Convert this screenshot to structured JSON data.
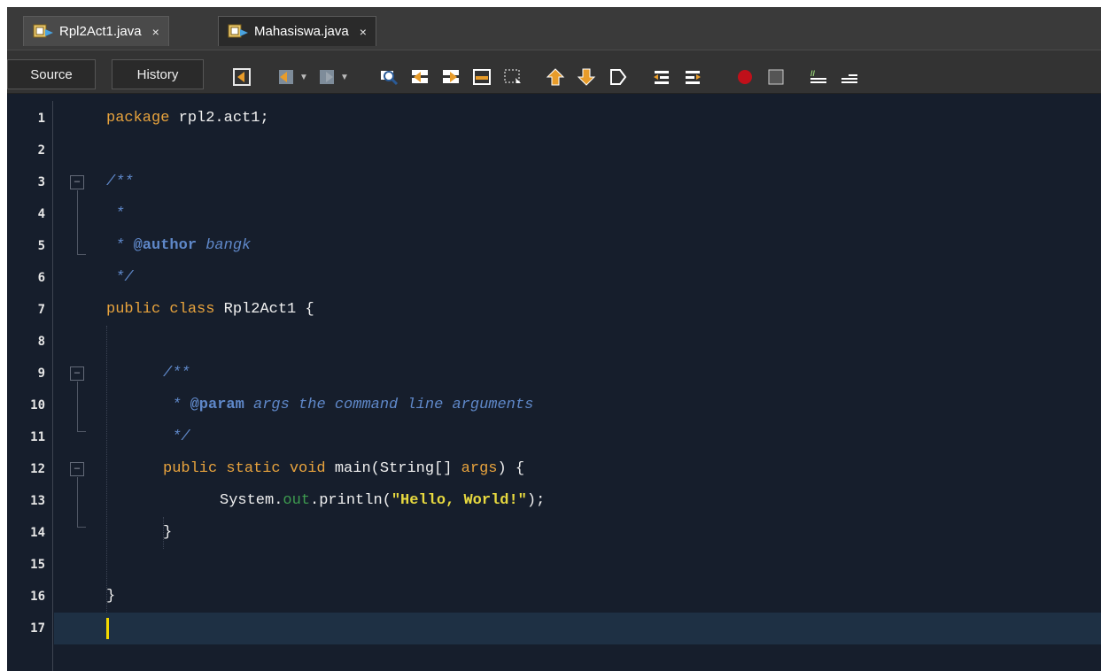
{
  "tabs": [
    {
      "label": "Rpl2Act1.java",
      "close": "×",
      "active": true
    },
    {
      "label": "Mahasiswa.java",
      "close": "×",
      "active": false
    }
  ],
  "toolbar": {
    "source_label": "Source",
    "history_label": "History",
    "icons": [
      "last-edit-icon",
      "back-icon",
      "forward-icon",
      "find-icon",
      "find-previous-icon",
      "find-next-icon",
      "toggle-highlight-icon",
      "toggle-rect-selection-icon",
      "previous-bookmark-icon",
      "next-bookmark-icon",
      "toggle-bookmark-icon",
      "shift-left-icon",
      "shift-right-icon",
      "record-macro-icon",
      "stop-macro-icon",
      "comment-icon",
      "uncomment-icon"
    ]
  },
  "editor": {
    "line_numbers": [
      "1",
      "2",
      "3",
      "4",
      "5",
      "6",
      "7",
      "8",
      "9",
      "10",
      "11",
      "12",
      "13",
      "14",
      "15",
      "16",
      "17"
    ],
    "lines": {
      "l1_kw": "package",
      "l1_rest": " rpl2.act1;",
      "l3": "/**",
      "l4": " *",
      "l5_star": " * ",
      "l5_tag": "@author",
      "l5_text": " bangk",
      "l6": " */",
      "l7_kw1": "public",
      "l7_kw2": "class",
      "l7_rest": " Rpl2Act1 {",
      "l9": "/**",
      "l10_star": " * ",
      "l10_tag": "@param",
      "l10_text": " args the command line arguments",
      "l11": " */",
      "l12_kw": "public static void",
      "l12_name": " main(String[] ",
      "l12_param": "args",
      "l12_end": ") {",
      "l13_a": "System.",
      "l13_field": "out",
      "l13_b": ".println(",
      "l13_str": "\"Hello, World!\"",
      "l13_c": ");",
      "l14": "}",
      "l16": "}"
    },
    "colors": {
      "background": "#161e2c",
      "keyword": "#e8a33d",
      "comment": "#5f88c9",
      "string": "#e7d93f",
      "field": "#3e9b4f",
      "caret": "#f2d800",
      "current_line": "#1e3044"
    }
  }
}
